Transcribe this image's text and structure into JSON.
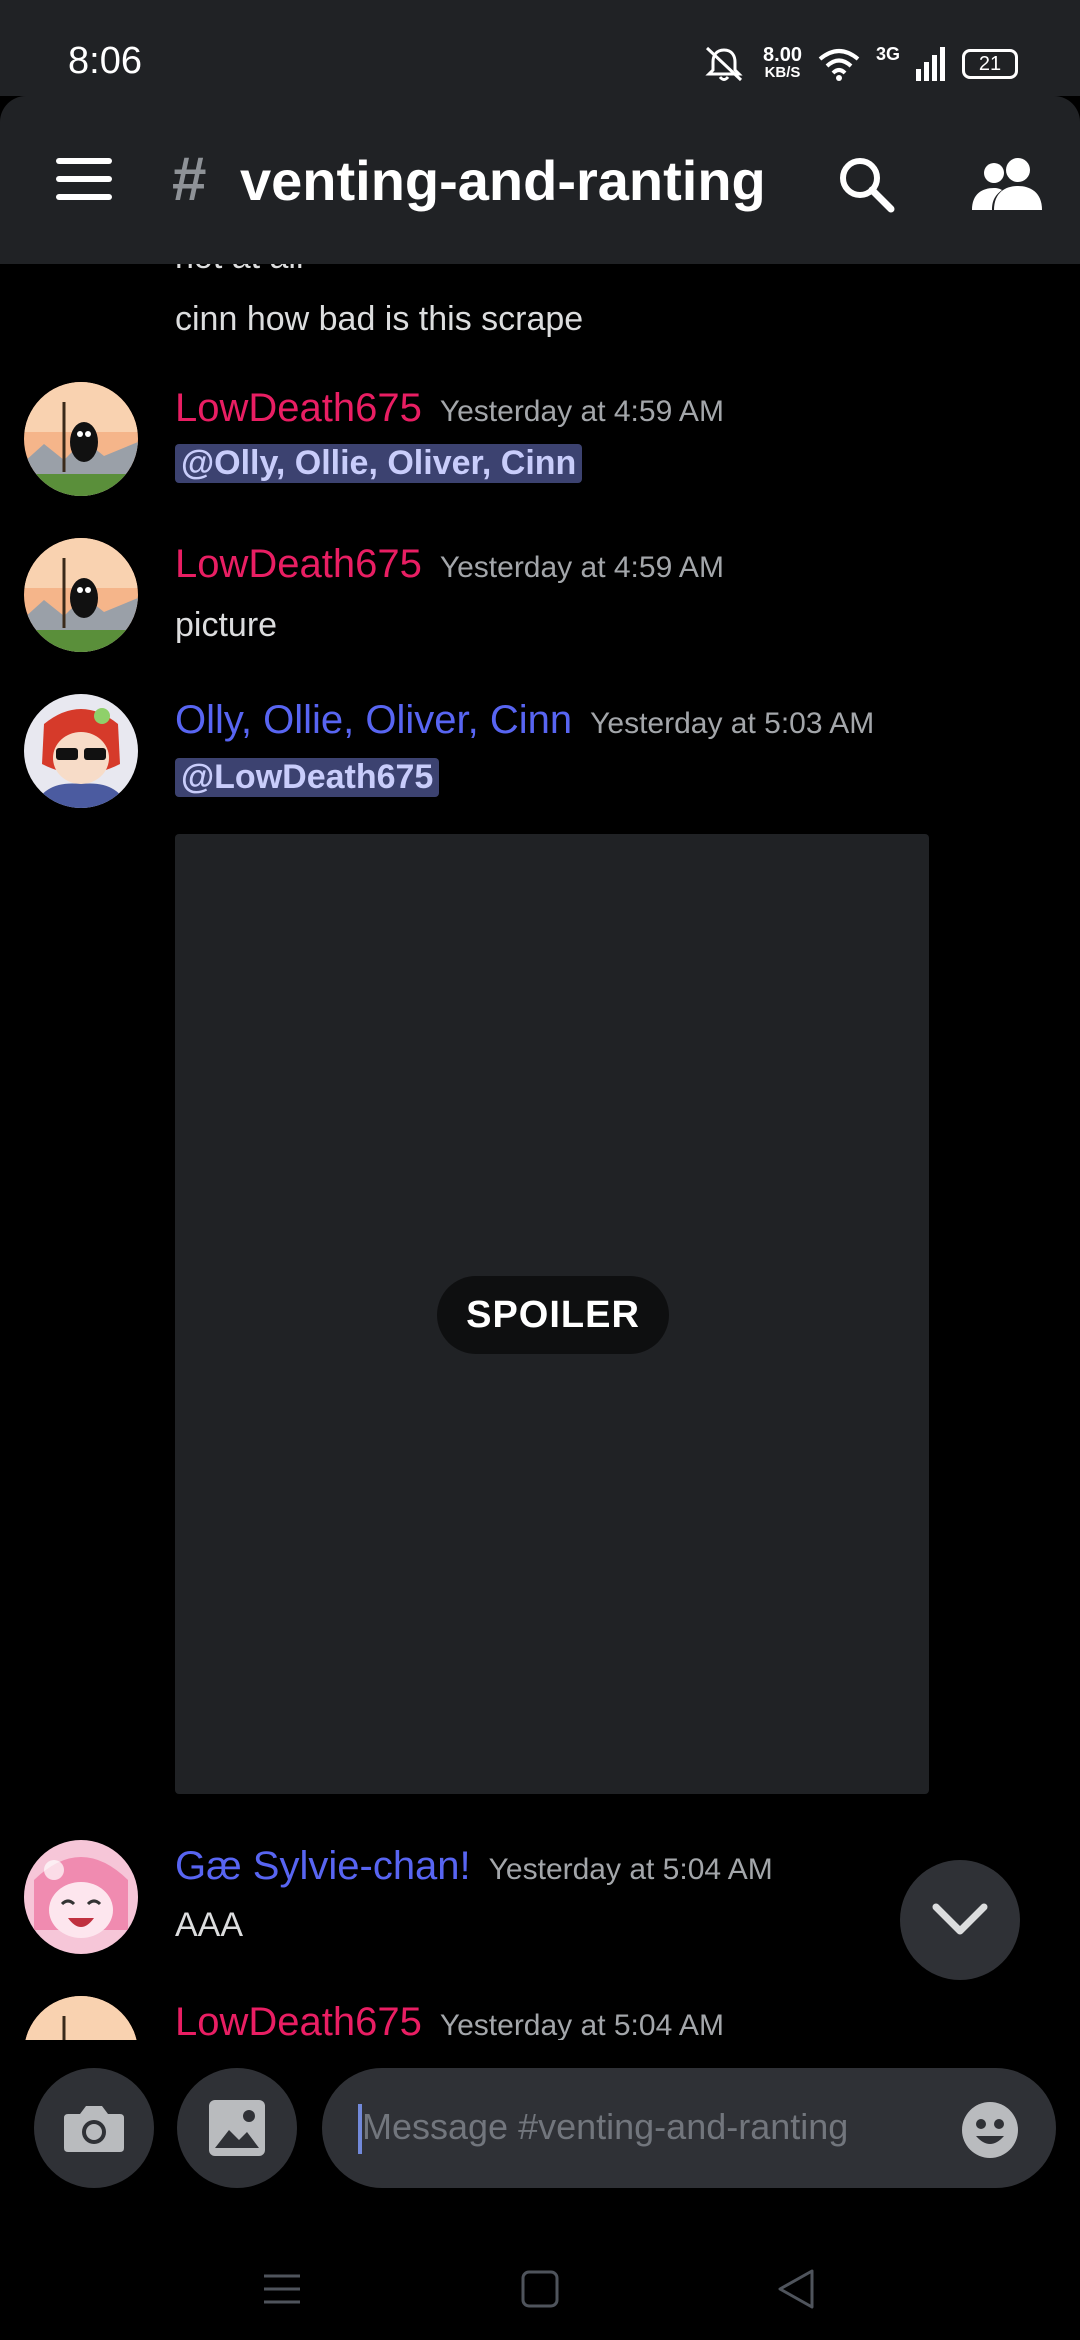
{
  "status": {
    "time": "8:06",
    "speed_value": "8.00",
    "speed_unit": "KB/S",
    "network": "3G",
    "battery": "21"
  },
  "header": {
    "channel_hash": "#",
    "channel_name": "venting-and-ranting"
  },
  "messages": {
    "cut_text": "not at all",
    "prev_text": "cinn how bad is this scrape",
    "m1": {
      "author": "LowDeath675",
      "time": "Yesterday at 4:59 AM",
      "mention": "@Olly, Ollie, Oliver, Cinn"
    },
    "m2": {
      "author": "LowDeath675",
      "time": "Yesterday at 4:59 AM",
      "text": "picture"
    },
    "m3": {
      "author": "Olly, Ollie, Oliver, Cinn",
      "time": "Yesterday at 5:03 AM",
      "mention": "@LowDeath675",
      "spoiler": "SPOILER"
    },
    "m4": {
      "author": "Gæ Sylvie-chan!",
      "time": "Yesterday at 5:04 AM",
      "text": "AAA"
    },
    "m5": {
      "author": "LowDeath675",
      "time": "Yesterday at 5:04 AM"
    }
  },
  "composer": {
    "placeholder": "Message #venting-and-ranting"
  },
  "colors": {
    "accent": "#5865f2",
    "red_name": "#e91e63",
    "mention_bg": "#3c4270",
    "bg": "#000000",
    "surface": "#202225"
  }
}
